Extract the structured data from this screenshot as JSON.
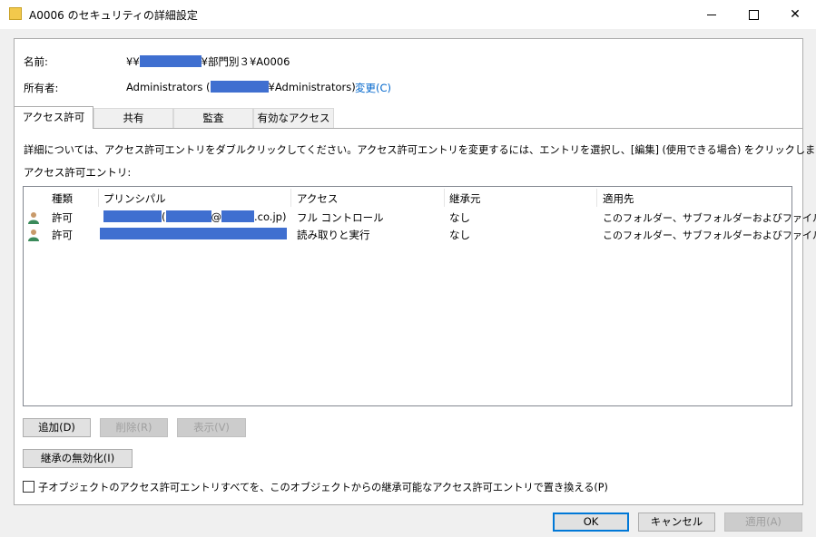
{
  "window": {
    "title": "A0006 のセキュリティの詳細設定"
  },
  "name_row": {
    "label": "名前:",
    "prefix": "¥¥",
    "suffix": "¥部門別３¥A0006"
  },
  "owner_row": {
    "label": "所有者:",
    "value_prefix": "Administrators (",
    "value_suffix": "¥Administrators)",
    "change_link": "変更(C)"
  },
  "tabs": [
    {
      "label": "アクセス許可",
      "active": true
    },
    {
      "label": "共有",
      "active": false
    },
    {
      "label": "監査",
      "active": false
    },
    {
      "label": "有効なアクセス",
      "active": false
    }
  ],
  "instructions": "詳細については、アクセス許可エントリをダブルクリックしてください。アクセス許可エントリを変更するには、エントリを選択し、[編集] (使用できる場合) をクリックします。",
  "list_label": "アクセス許可エントリ:",
  "columns": [
    "種類",
    "プリンシパル",
    "アクセス",
    "継承元",
    "適用先"
  ],
  "rows": [
    {
      "type": "許可",
      "principal_parts": [
        "(",
        "@",
        ".co.jp)"
      ],
      "access": "フル コントロール",
      "inherited": "なし",
      "applies": "このフォルダー、サブフォルダーおよびファイル"
    },
    {
      "type": "許可",
      "principal_parts": [],
      "access": "読み取りと実行",
      "inherited": "なし",
      "applies": "このフォルダー、サブフォルダーおよびファイル"
    }
  ],
  "buttons": {
    "add": "追加(D)",
    "remove": "削除(R)",
    "view": "表示(V)",
    "disable_inheritance": "継承の無効化(I)",
    "ok": "OK",
    "cancel": "キャンセル",
    "apply": "適用(A)"
  },
  "replace_checkbox": {
    "label": "子オブジェクトのアクセス許可エントリすべてを、このオブジェクトからの継承可能なアクセス許可エントリで置き換える(P)",
    "checked": false
  },
  "colors": {
    "redaction": "#3f6fd0",
    "link": "#0066cc",
    "default_button_border": "#0078d7"
  },
  "icons": [
    "folder-icon",
    "minimize-icon",
    "maximize-icon",
    "close-icon",
    "user-icon"
  ]
}
